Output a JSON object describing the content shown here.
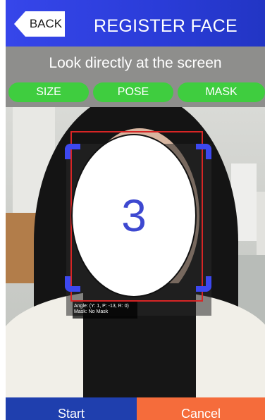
{
  "header": {
    "back_label": "BACK",
    "title": "REGISTER FACE",
    "back_icon": "back-arrow-icon"
  },
  "instruction": "Look directly at the screen",
  "checks": [
    {
      "label": "SIZE"
    },
    {
      "label": "POSE"
    },
    {
      "label": "MASK"
    }
  ],
  "camera": {
    "countdown": "3",
    "angle_text": "Angle: (Y: 1, P: -13, R: 0)",
    "mask_text": "Mask: No Mask"
  },
  "buttons": {
    "start_label": "Start",
    "cancel_label": "Cancel"
  },
  "colors": {
    "header": "#2a3cd8",
    "check_pill": "#3fcd3f",
    "guide_corners": "#3d48f0",
    "detection_box": "#d72525",
    "start": "#1f3fae",
    "cancel": "#f56c3b"
  }
}
